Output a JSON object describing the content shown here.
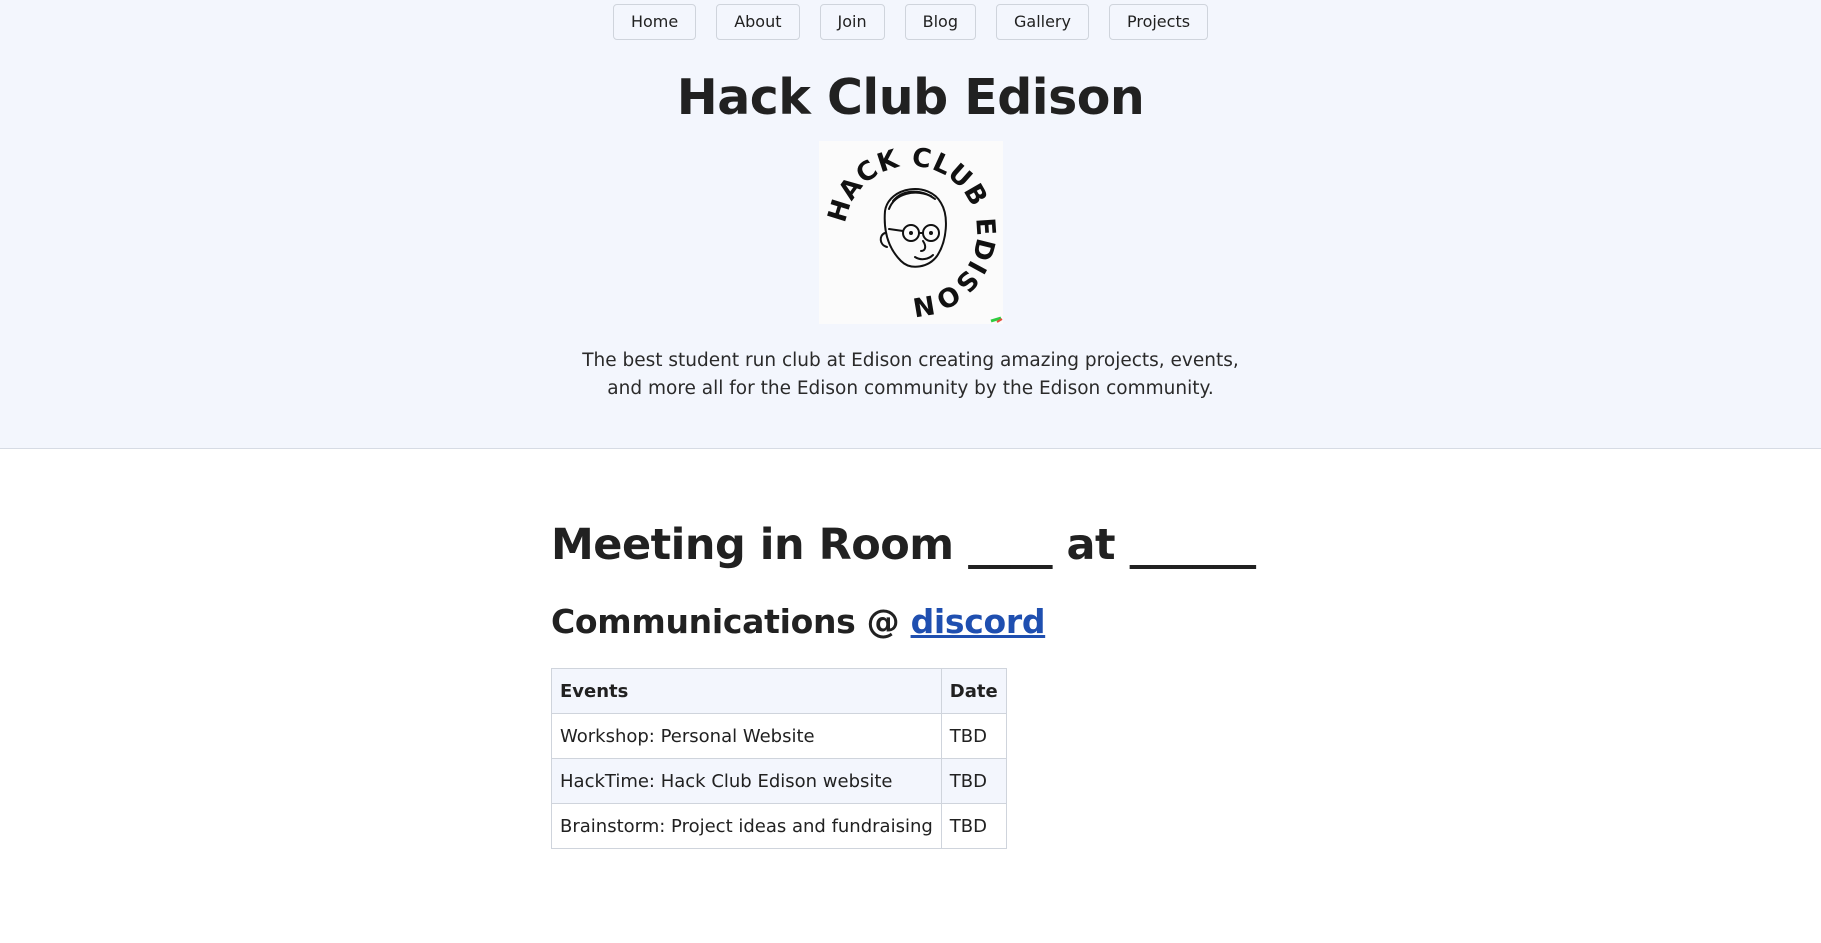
{
  "nav": {
    "items": [
      {
        "label": "Home"
      },
      {
        "label": "About"
      },
      {
        "label": "Join"
      },
      {
        "label": "Blog"
      },
      {
        "label": "Gallery"
      },
      {
        "label": "Projects"
      }
    ]
  },
  "header": {
    "title": "Hack Club Edison",
    "logo_text": "HACK CLUB EDISON",
    "tagline_line1": "The best student run club at Edison creating amazing projects, events,",
    "tagline_line2": "and more all for the Edison community by the Edison community."
  },
  "main": {
    "meeting_heading": "Meeting in Room ____ at ______",
    "comms_prefix": "Communications @ ",
    "comms_link": "discord",
    "table": {
      "headers": [
        "Events",
        "Date"
      ],
      "rows": [
        [
          "Workshop: Personal Website",
          "TBD"
        ],
        [
          "HackTime: Hack Club Edison website",
          "TBD"
        ],
        [
          "Brainstorm: Project ideas and fundraising",
          "TBD"
        ]
      ]
    }
  },
  "colors": {
    "header_bg": "#f3f6fd",
    "link": "#1f4fb0",
    "border": "#cfd4dc"
  }
}
